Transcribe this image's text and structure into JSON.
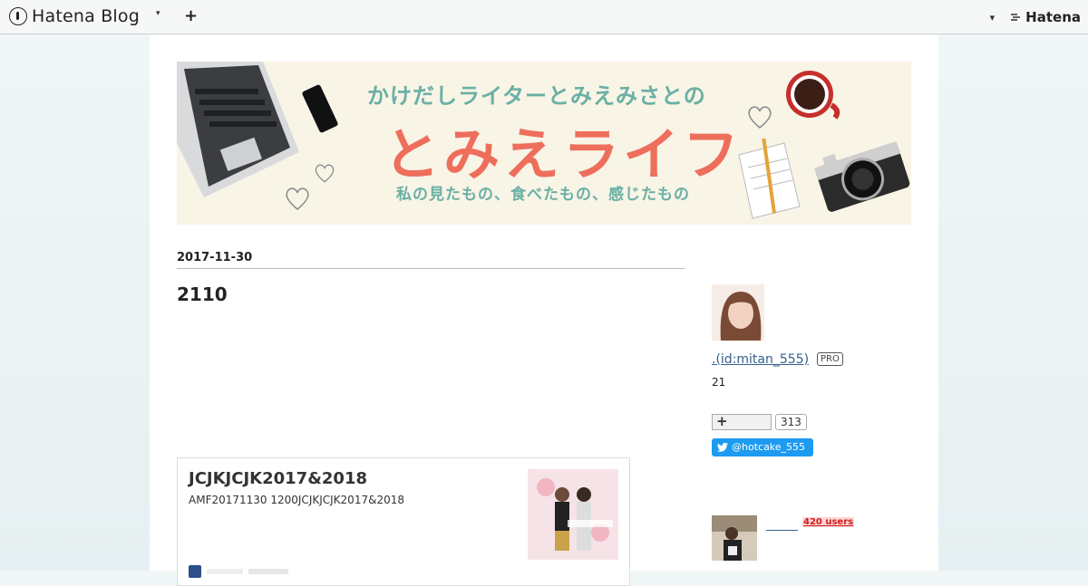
{
  "topbar": {
    "logo_text": "Hatena Blog",
    "logo_icon": "hatena-blog-icon",
    "dropdown_caret": "▾",
    "add_icon": "+",
    "right_caret": "▾",
    "right_logo_text": "Hatena"
  },
  "banner": {
    "subtitle": "かけだしライターとみえみさとの",
    "title": "とみえライフ",
    "caption": "私の見たもの、食べたもの、感じたもの"
  },
  "article": {
    "date": "2017-11-30",
    "title": "2110",
    "embed": {
      "title": "JCJKJCJK2017&2018",
      "description": "AMF20171130 1200JCJKJCJK2017&2018"
    }
  },
  "sidebar": {
    "profile_link": ".(id:mitan_555)",
    "pro_badge": "PRO",
    "count": "21",
    "subscribe_icon": "+",
    "subscriber_count": "313",
    "twitter_label": "@hotcake_555",
    "users_badge": "420 users"
  },
  "colors": {
    "accent_teal": "#6ab0a4",
    "accent_coral": "#ee6e5c",
    "link_blue": "#35608d",
    "twitter_blue": "#1d9bf0",
    "users_red": "#d31c1c"
  }
}
